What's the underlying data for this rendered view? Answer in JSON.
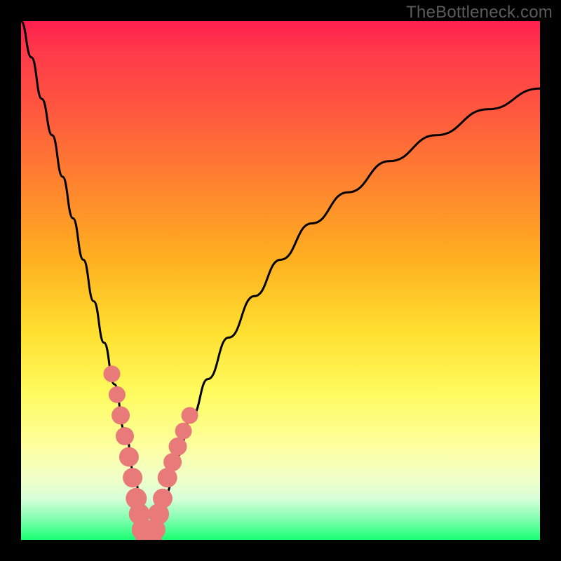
{
  "watermark": "TheBottleneck.com",
  "colors": {
    "frame": "#000000",
    "curve": "#000000",
    "marker_fill": "#e87a7a",
    "marker_stroke": "#d66a6a",
    "gradient_top": "#ff1f4f",
    "gradient_bottom": "#18ff70"
  },
  "chart_data": {
    "type": "line",
    "title": "",
    "xlabel": "",
    "ylabel": "",
    "xlim": [
      0,
      100
    ],
    "ylim": [
      0,
      100
    ],
    "grid": false,
    "series": [
      {
        "name": "bottleneck-curve",
        "x": [
          0,
          2,
          4,
          6,
          8,
          10,
          12,
          14,
          16,
          18,
          20,
          22,
          23,
          24,
          25,
          26,
          28,
          30,
          33,
          36,
          40,
          45,
          50,
          56,
          63,
          71,
          80,
          90,
          100
        ],
        "y": [
          100,
          93,
          85,
          78,
          70,
          62,
          54,
          46,
          38,
          30,
          21,
          12,
          7,
          3,
          0,
          3,
          9,
          16,
          24,
          31,
          39,
          47,
          54,
          61,
          67,
          73,
          78,
          83,
          87
        ]
      }
    ],
    "markers": {
      "name": "highlighted-points",
      "x": [
        17.5,
        18.5,
        19.2,
        20.0,
        20.8,
        21.5,
        22.2,
        22.8,
        23.5,
        24.2,
        25.0,
        25.8,
        26.5,
        27.3,
        28.2,
        29.2,
        30.2,
        31.3,
        32.5
      ],
      "y": [
        32,
        28,
        24,
        20,
        16,
        12,
        8,
        5,
        2,
        0,
        0,
        2,
        5,
        8,
        12,
        15,
        18,
        21,
        24
      ],
      "size": [
        12,
        12,
        13,
        13,
        14,
        14,
        15,
        15,
        16,
        16,
        16,
        15,
        15,
        14,
        14,
        13,
        13,
        12,
        12
      ]
    }
  }
}
